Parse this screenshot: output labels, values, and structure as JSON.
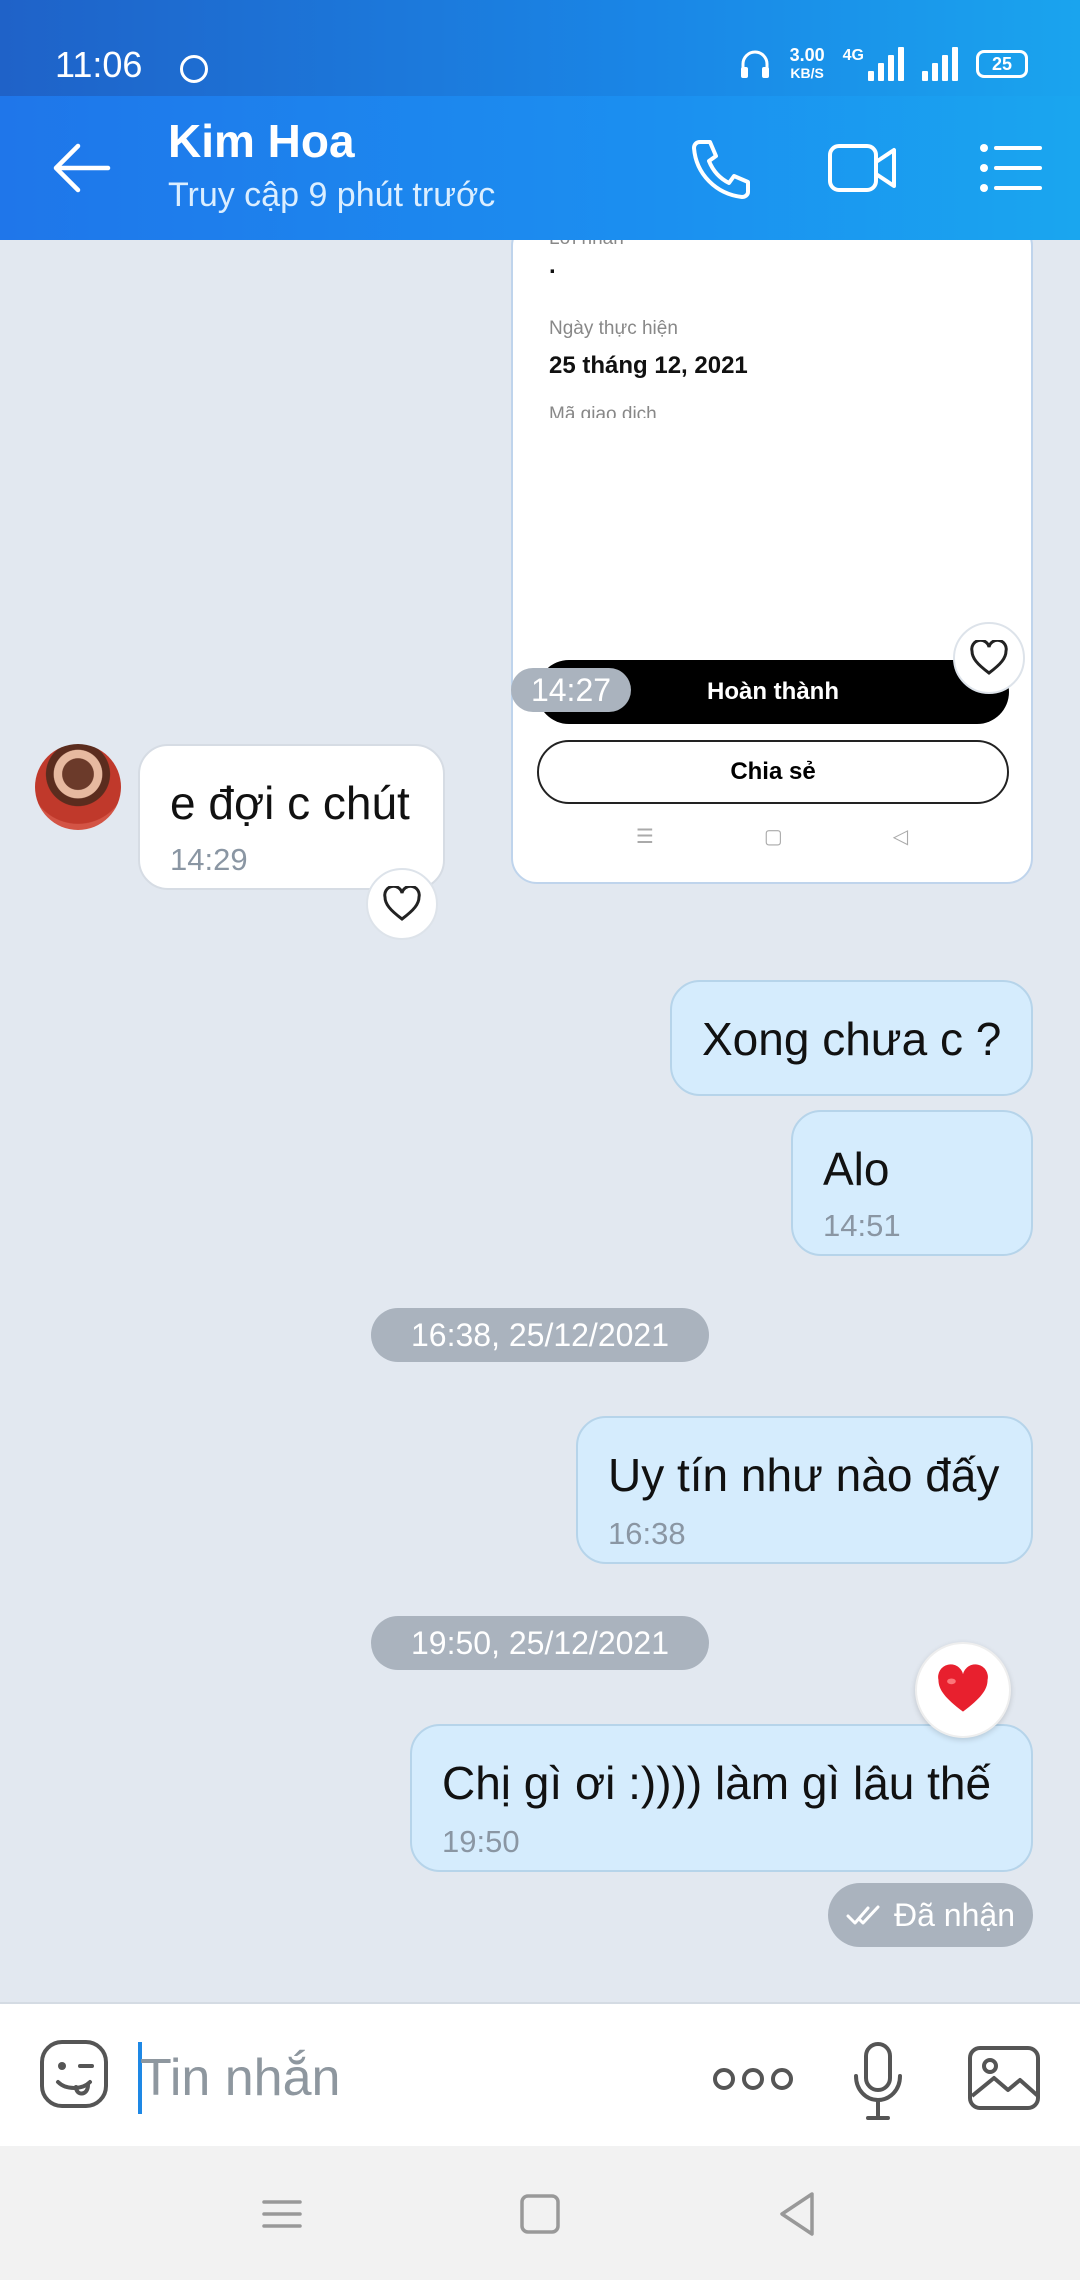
{
  "status_bar": {
    "time": "11:06",
    "speed_value": "3.00",
    "speed_unit": "KB/S",
    "network": "4G",
    "battery": "25"
  },
  "header": {
    "contact_name": "Kim Hoa",
    "contact_status": "Truy cập 9 phút trước"
  },
  "receipt_card": {
    "partial_label_top": "Lời nhắn",
    "note_value": ".",
    "date_label": "Ngày thực hiện",
    "date_value": "25 tháng 12, 2021",
    "partial_label_bottom": "Mã giao dịch",
    "done_button": "Hoàn thành",
    "share_button": "Chia sẻ"
  },
  "messages": [
    {
      "type": "time_pill",
      "text": "14:27"
    },
    {
      "type": "incoming",
      "text": "e đợi c chút",
      "time": "14:29"
    },
    {
      "type": "outgoing",
      "text": "Xong chưa c ?"
    },
    {
      "type": "outgoing",
      "text": "Alo",
      "time": "14:51"
    },
    {
      "type": "time_pill",
      "text": "16:38, 25/12/2021"
    },
    {
      "type": "outgoing",
      "text": "Uy tín như nào đấy",
      "time": "16:38"
    },
    {
      "type": "time_pill",
      "text": "19:50, 25/12/2021"
    },
    {
      "type": "outgoing",
      "text": "Chị gì ơi :)))) làm gì lâu thế",
      "time": "19:50"
    }
  ],
  "delivery_status": "Đã nhận",
  "input": {
    "placeholder": "Tin nhắn"
  },
  "colors": {
    "header_blue": "#1b8ff0",
    "outgoing_bubble": "#d5ecfd",
    "chat_background": "#e2e8f0",
    "heart_red": "#e8202e"
  }
}
